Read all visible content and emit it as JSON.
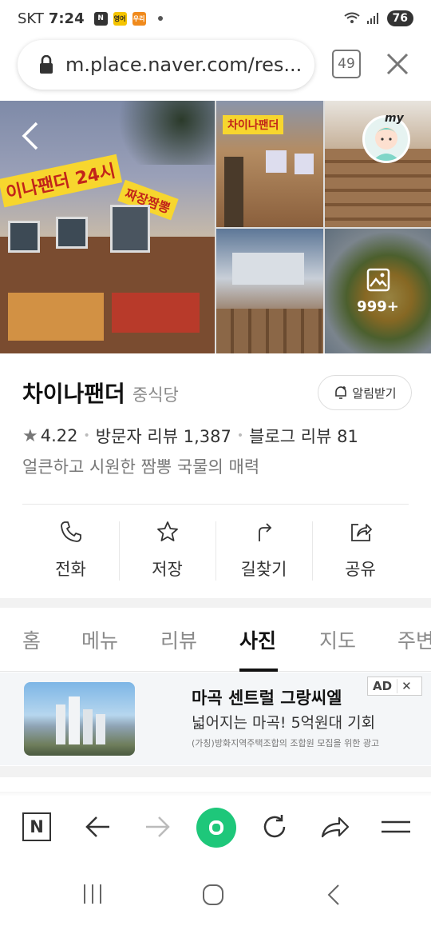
{
  "status_bar": {
    "carrier": "SKT",
    "time": "7:24",
    "notif_icons": [
      "N",
      "영어",
      "우리"
    ],
    "battery": "76"
  },
  "browser": {
    "url": "m.place.naver.com/res...",
    "tab_count": "49"
  },
  "photos": {
    "main_sign": "이나팬더 24시",
    "side_sign": "짜장짬뽕",
    "more_count": "999+"
  },
  "place": {
    "name": "차이나팬더",
    "category": "중식당",
    "alarm_label": "알림받기",
    "rating": "4.22",
    "visitor_review_label": "방문자 리뷰",
    "visitor_review_count": "1,387",
    "blog_review_label": "블로그 리뷰",
    "blog_review_count": "81",
    "description": "얼큰하고 시원한 짬뽕 국물의 매력"
  },
  "actions": [
    {
      "label": "전화",
      "icon": "phone-icon"
    },
    {
      "label": "저장",
      "icon": "star-icon"
    },
    {
      "label": "길찾기",
      "icon": "directions-icon"
    },
    {
      "label": "공유",
      "icon": "share-icon"
    }
  ],
  "tabs": [
    {
      "label": "홈",
      "active": false
    },
    {
      "label": "메뉴",
      "active": false
    },
    {
      "label": "리뷰",
      "active": false
    },
    {
      "label": "사진",
      "active": true
    },
    {
      "label": "지도",
      "active": false
    },
    {
      "label": "주변",
      "active": false
    }
  ],
  "ad": {
    "title": "마곡 센트럴 그랑씨엘",
    "subtitle": "넓어지는 마곡! 5억원대 기회",
    "note": "(가칭)방화지역주택조합의 조합원 모집을 위한 광고",
    "badge": "AD",
    "badge_close": "✕"
  },
  "toolbar": {
    "n_label": "N"
  },
  "colors": {
    "naver_green": "#1ec77a",
    "sign_yellow": "#f7d62e"
  }
}
